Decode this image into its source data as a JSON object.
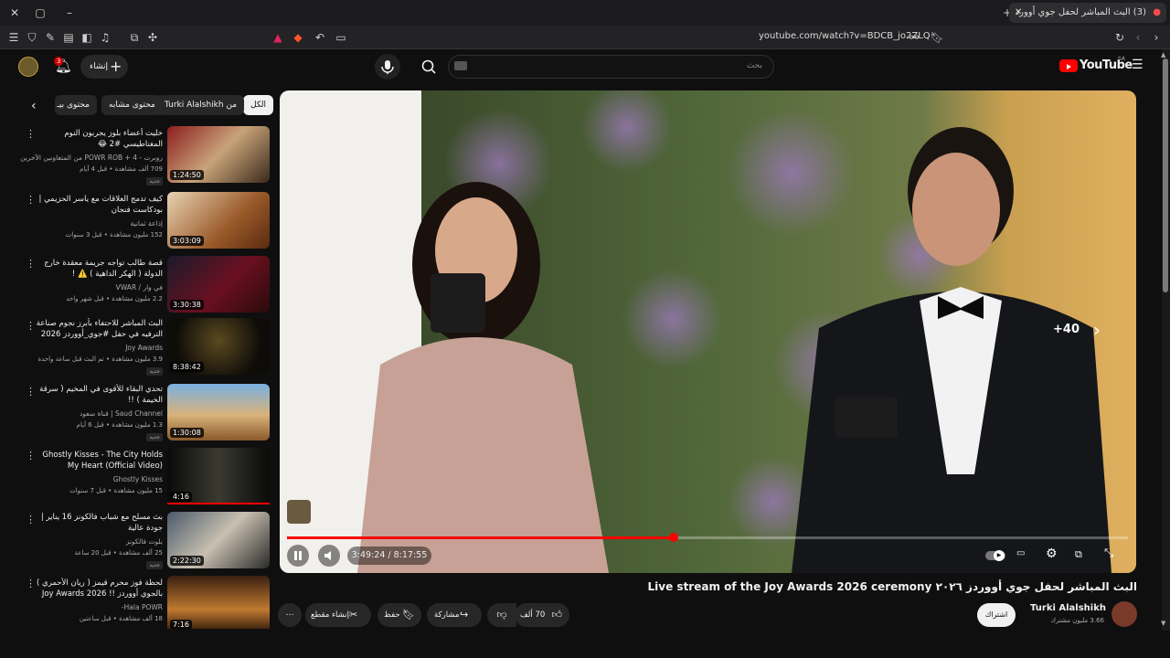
{
  "browser": {
    "tab_title": "(3) البث المباشر لحفل جوي أوورد",
    "url": "youtube.com/watch?v=BDCB_jo2ZLQ"
  },
  "header": {
    "create_label": "إنشاء",
    "notifications_count": "3",
    "search_placeholder": "بحث",
    "logo_text": "YouTube",
    "logo_region": "SA"
  },
  "chips": [
    {
      "label": "الكل"
    },
    {
      "label": "من Turki Alalshikh"
    },
    {
      "label": "محتوى مشابه"
    },
    {
      "label": "محتوى بيـ"
    }
  ],
  "sidebar": {
    "items": [
      {
        "title": "خليت أعضاء بلوز يجربون النوم المغناطيسي #2 😂",
        "channel": "روبرت - POWR ROB + 4 من المتعاونين الآخرين",
        "meta": "709 ألف مشاهدة • قبل 4 أيام",
        "badge": "جديد",
        "duration": "1:24:50"
      },
      {
        "title": "كيف تدمج العلاقات مع ياسر الحزيمي | بودكاست فنجان",
        "channel": "إذاعة ثمانية",
        "meta": "152 مليون مشاهدة • قبل 3 سنوات",
        "badge": "",
        "duration": "3:03:09"
      },
      {
        "title": "قصة طالب تواجه جريمة معقدة خارج الدولة ( الهكر الداهية ) ⚠️ !",
        "channel": "في وار / VWAR",
        "meta": "2.2 مليون مشاهدة • قبل شهر واحد",
        "badge": "",
        "duration": "3:30:38"
      },
      {
        "title": "البث المباشر للاحتفاء بأبرز نجوم صناعة الترفيه في حفل #جوي_أووردز 2026",
        "channel": "Joy Awards",
        "meta": "3.9 مليون مشاهدة • تم البث قبل ساعة واحدة",
        "badge": "جديد",
        "duration": "8:38:42"
      },
      {
        "title": "تحدي البقاء للأقوى في المخيم ( سرقة الخيمة ) !!",
        "channel": "Saud Channel | قناة سعود",
        "meta": "1.3 مليون مشاهدة • قبل 6 أيام",
        "badge": "جديد",
        "duration": "1:30:08"
      },
      {
        "title": "Ghostly Kisses - The City Holds My Heart (Official Video)",
        "channel": "Ghostly Kisses",
        "meta": "15 مليون مشاهدة • قبل 7 سنوات",
        "badge": "",
        "duration": "4:16"
      },
      {
        "title": "بث مسلح مع شباب فالكونز 16 يناير | جودة عالية",
        "channel": "بلوت فالكونز",
        "meta": "25 ألف مشاهدة • قبل 20 ساعة",
        "badge": "جديد",
        "duration": "2:22:30"
      },
      {
        "title": "لحظة فوز محرم قيمز ( ريان الأحمري ) بالجوي أووردز !! Joy Awards 2026",
        "channel": "Hala POWR-",
        "meta": "18 ألف مشاهدة • قبل ساعتين",
        "badge": "",
        "duration": "7:16"
      }
    ]
  },
  "player": {
    "overlay_count": "+40",
    "time_current": "3:49:24",
    "time_total": "8:17:55",
    "progress": 0.46
  },
  "video": {
    "title": "البث المباشر لحفل جوي أووردز ٢٠٢٦ Live stream of the Joy Awards 2026 ceremony",
    "channel": "Turki Alalshikh",
    "subscribers": "3.66 مليون مشترك",
    "subscribe_label": "اشتراك",
    "like_count": "70 ألف",
    "share_label": "مشاركة",
    "save_label": "حفظ",
    "clip_label": "إنشاء مقطع"
  },
  "colors": {
    "accent": "#ff0000",
    "background": "#0f0f0f",
    "chip": "#272727"
  }
}
